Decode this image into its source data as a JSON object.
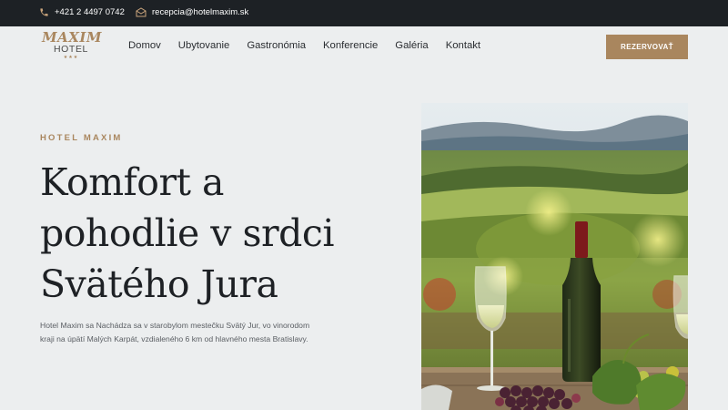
{
  "topbar": {
    "phone": "+421 2 4497 0742",
    "email": "recepcia@hotelmaxim.sk",
    "phone_icon": "phone-icon",
    "email_icon": "envelope-icon"
  },
  "logo": {
    "brand": "MAXIM",
    "subtitle": "HOTEL",
    "stars": "★★★"
  },
  "nav": {
    "items": [
      "Domov",
      "Ubytovanie",
      "Gastronómia",
      "Konferencie",
      "Galéria",
      "Kontakt"
    ]
  },
  "header": {
    "reserve_label": "REZERVOVAŤ"
  },
  "hero": {
    "eyebrow": "HOTEL MAXIM",
    "headline_lines": [
      "Komfort a",
      "pohodlie v srdci",
      "Svätého Jura"
    ],
    "description": "Hotel Maxim sa Nachádza sa v starobylom mestečku Svätý Jur, vo vinorodom kraji na úpätí Malých Karpát, vzdialeného 6 km od hlavného mesta Bratislavy."
  },
  "colors": {
    "accent": "#a9865e",
    "topbar_bg": "#1d2125",
    "page_bg": "#eceeef",
    "text_dark": "#1e2125"
  }
}
